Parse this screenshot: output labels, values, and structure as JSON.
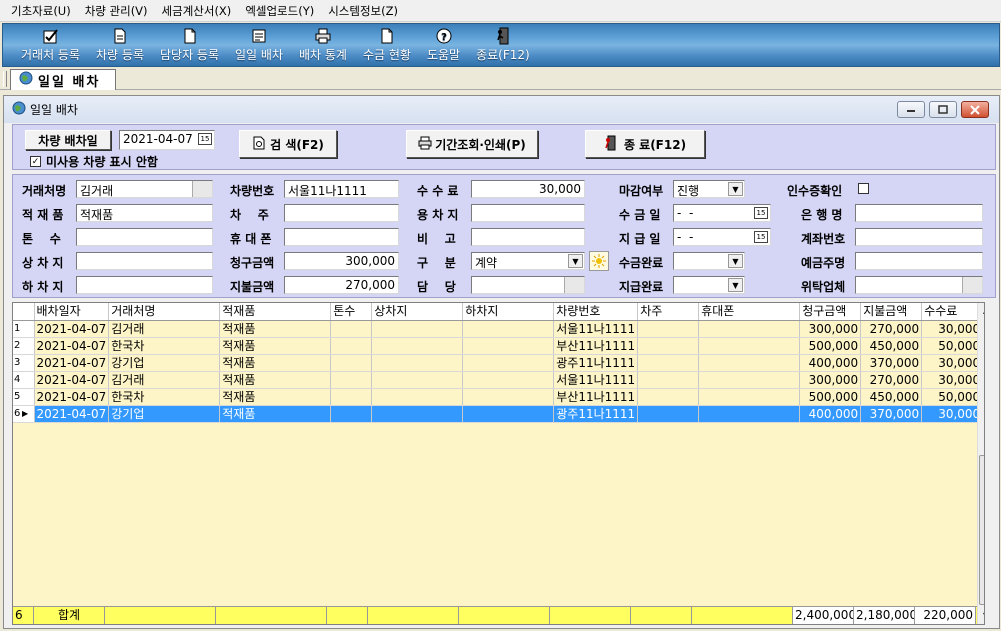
{
  "menu": [
    "기초자료(U)",
    "차량 관리(V)",
    "세금계산서(X)",
    "엑셀업로드(Y)",
    "시스템정보(Z)"
  ],
  "toolbar": [
    {
      "label": "거래처 등록",
      "icon": "checkbox-icon"
    },
    {
      "label": "차량 등록",
      "icon": "document-edit-icon"
    },
    {
      "label": "담당자 등록",
      "icon": "document-icon"
    },
    {
      "label": "일일 배차",
      "icon": "report-icon"
    },
    {
      "label": "배차 통계",
      "icon": "printer-icon"
    },
    {
      "label": "수금 현황",
      "icon": "document-icon"
    },
    {
      "label": "도움말",
      "icon": "help-icon"
    },
    {
      "label": "종료(F12)",
      "icon": "exit-door-icon"
    }
  ],
  "tab": {
    "label": "일일 배차"
  },
  "window": {
    "title": "일일 배차"
  },
  "search": {
    "date_button": "차량 배차일",
    "date_value": "2021-04-07",
    "unused_checkbox": "미사용 차량 표시 안함",
    "unused_checked": true,
    "search_button": "검 색(F2)",
    "period_button": "기간조회·인쇄(P)",
    "exit_button": "종 료(F12)"
  },
  "form": {
    "client_label": "거래처명",
    "client_value": "김거래",
    "cargo_label": "적 재 품",
    "cargo_value": "적재품",
    "tons_label": "톤    수",
    "tons_value": "",
    "load_label": "상 차 지",
    "load_value": "",
    "unload_label": "하 차 지",
    "unload_value": "",
    "vehicle_no_label": "차량번호",
    "vehicle_no_value": "서울11나1111",
    "owner_label": "차    주",
    "owner_value": "",
    "mobile_label": "휴 대 폰",
    "mobile_value": "",
    "billed_label": "청구금액",
    "billed_value": "300,000",
    "paid_label": "지불금액",
    "paid_value": "270,000",
    "fee_label": "수 수 료",
    "fee_value": "30,000",
    "yongcha_label": "용 차 지",
    "yongcha_value": "",
    "remark_label": "비    고",
    "remark_value": "",
    "type_label": "구    분",
    "type_value": "계약",
    "manager_label": "담    당",
    "manager_value": "",
    "closed_label": "마감여부",
    "closed_value": "진행",
    "collect_date_label": "수 금 일",
    "collect_date_value": "-  -",
    "pay_date_label": "지 급 일",
    "pay_date_value": "-  -",
    "collect_done_label": "수금완료",
    "collect_done_value": "",
    "pay_done_label": "지급완료",
    "pay_done_value": "",
    "receipt_label": "인수증확인",
    "bank_label": "은 행 명",
    "bank_value": "",
    "account_label": "계좌번호",
    "account_value": "",
    "holder_label": "예금주명",
    "holder_value": "",
    "consign_label": "위탁업체",
    "consign_value": ""
  },
  "grid": {
    "columns": [
      "배차일자",
      "거래처명",
      "적재품",
      "톤수",
      "상차지",
      "하차지",
      "차량번호",
      "차주",
      "휴대폰",
      "청구금액",
      "지불금액",
      "수수료"
    ],
    "rows": [
      [
        "1",
        "2021-04-07",
        "김거래",
        "적재품",
        "",
        "",
        "",
        "서울11나1111",
        "",
        "",
        "300,000",
        "270,000",
        "30,000"
      ],
      [
        "2",
        "2021-04-07",
        "한국차",
        "적재품",
        "",
        "",
        "",
        "부산11나1111",
        "",
        "",
        "500,000",
        "450,000",
        "50,000"
      ],
      [
        "3",
        "2021-04-07",
        "강기업",
        "적재품",
        "",
        "",
        "",
        "광주11나1111",
        "",
        "",
        "400,000",
        "370,000",
        "30,000"
      ],
      [
        "4",
        "2021-04-07",
        "김거래",
        "적재품",
        "",
        "",
        "",
        "서울11나1111",
        "",
        "",
        "300,000",
        "270,000",
        "30,000"
      ],
      [
        "5",
        "2021-04-07",
        "한국차",
        "적재품",
        "",
        "",
        "",
        "부산11나1111",
        "",
        "",
        "500,000",
        "450,000",
        "50,000"
      ],
      [
        "6",
        "2021-04-07",
        "강기업",
        "적재품",
        "",
        "",
        "",
        "광주11나1111",
        "",
        "",
        "400,000",
        "370,000",
        "30,000"
      ]
    ],
    "selected_row": 6,
    "total": {
      "count": "6",
      "label": "합계",
      "billed": "2,400,000",
      "paid": "2,180,000",
      "fee": "220,000"
    }
  }
}
